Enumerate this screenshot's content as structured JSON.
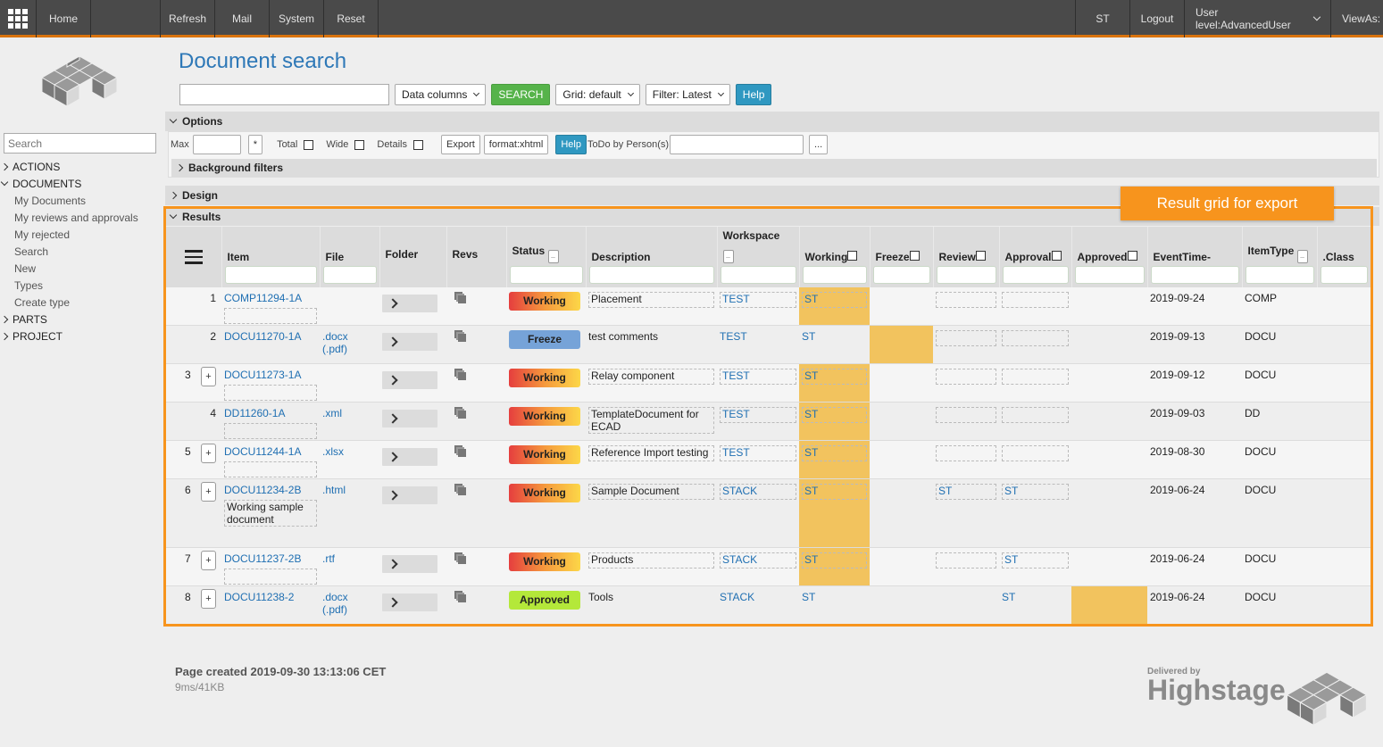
{
  "topbar": {
    "home": "Home",
    "refresh": "Refresh",
    "mail": "Mail",
    "system": "System",
    "reset": "Reset",
    "user": "ST",
    "logout": "Logout",
    "user_level": "User level:AdvancedUser",
    "view_as": "ViewAs:",
    "accent": "#d9730d"
  },
  "sidebar": {
    "search_placeholder": "Search",
    "sections": [
      {
        "label": "ACTIONS",
        "expanded": false
      },
      {
        "label": "DOCUMENTS",
        "expanded": true,
        "items": [
          "My Documents",
          "My reviews and approvals",
          "My rejected",
          "Search",
          "New",
          "Types",
          "Create type"
        ]
      },
      {
        "label": "PARTS",
        "expanded": false
      },
      {
        "label": "PROJECT",
        "expanded": false
      }
    ]
  },
  "page": {
    "title": "Document search",
    "search_value": "",
    "data_columns": "Data columns",
    "search_button": "SEARCH",
    "grid_select": "Grid: default",
    "filter_select": "Filter: Latest",
    "help": "Help"
  },
  "options": {
    "title": "Options",
    "max_label": "Max",
    "max_value": "",
    "star": "*",
    "total": "Total",
    "wide": "Wide",
    "details": "Details",
    "export": "Export",
    "format": "format:xhtml",
    "help": "Help",
    "todo_label": "ToDo by Person(s)",
    "todo_value": "",
    "more": "...",
    "background_filters": "Background filters"
  },
  "design": {
    "title": "Design"
  },
  "results": {
    "title": "Results",
    "callout": "Result grid for export",
    "columns": [
      "Item",
      "File",
      "Folder",
      "Revs",
      "Status",
      "Description",
      "Workspace",
      "Working",
      "Freeze",
      "Review",
      "Approval",
      "Approved",
      "EventTime-",
      "ItemType",
      ".Class"
    ],
    "rows": [
      {
        "num": "1",
        "plus": false,
        "item": "COMP11294-1A",
        "note": "",
        "file": "",
        "file2": "",
        "status": "Working",
        "description": "Placement",
        "workspace": "TEST",
        "working": "ST",
        "freeze": "",
        "review": "",
        "approval": "",
        "approved": "",
        "event_time": "2019-09-24",
        "item_type": "COMP",
        "class": ""
      },
      {
        "num": "2",
        "plus": false,
        "item": "DOCU11270-1A",
        "note": "",
        "file": ".docx",
        "file2": "(.pdf)",
        "status": "Freeze",
        "description": "test comments",
        "workspace": "TEST",
        "working": "ST",
        "freeze": "",
        "review": "",
        "approval": "",
        "approved": "",
        "event_time": "2019-09-13",
        "item_type": "DOCU",
        "class": ""
      },
      {
        "num": "3",
        "plus": true,
        "item": "DOCU11273-1A",
        "note": "",
        "file": "",
        "file2": "",
        "status": "Working",
        "description": "Relay component",
        "workspace": "TEST",
        "working": "ST",
        "freeze": "",
        "review": "",
        "approval": "",
        "approved": "",
        "event_time": "2019-09-12",
        "item_type": "DOCU",
        "class": ""
      },
      {
        "num": "4",
        "plus": false,
        "item": "DD11260-1A",
        "note": "",
        "file": ".xml",
        "file2": "",
        "status": "Working",
        "description": "TemplateDocument for ECAD",
        "workspace": "TEST",
        "working": "ST",
        "freeze": "",
        "review": "",
        "approval": "",
        "approved": "",
        "event_time": "2019-09-03",
        "item_type": "DD",
        "class": ""
      },
      {
        "num": "5",
        "plus": true,
        "item": "DOCU11244-1A",
        "note": "",
        "file": ".xlsx",
        "file2": "",
        "status": "Working",
        "description": "Reference Import testing",
        "workspace": "TEST",
        "working": "ST",
        "freeze": "",
        "review": "",
        "approval": "",
        "approved": "",
        "event_time": "2019-08-30",
        "item_type": "DOCU",
        "class": ""
      },
      {
        "num": "6",
        "plus": true,
        "item": "DOCU11234-2B",
        "note": "Working sample document",
        "file": ".html",
        "file2": "",
        "status": "Working",
        "description": "Sample Document",
        "workspace": "STACK",
        "working": "ST",
        "freeze": "",
        "review": "ST",
        "approval": "ST",
        "approved": "",
        "event_time": "2019-06-24",
        "item_type": "DOCU",
        "class": ""
      },
      {
        "num": "7",
        "plus": true,
        "item": "DOCU11237-2B",
        "note": "",
        "file": ".rtf",
        "file2": "",
        "status": "Working",
        "description": "Products",
        "workspace": "STACK",
        "working": "ST",
        "freeze": "",
        "review": "",
        "approval": "ST",
        "approved": "",
        "event_time": "2019-06-24",
        "item_type": "DOCU",
        "class": ""
      },
      {
        "num": "8",
        "plus": true,
        "item": "DOCU11238-2",
        "note": "",
        "file": ".docx",
        "file2": "(.pdf)",
        "status": "Approved",
        "description": "Tools",
        "workspace": "STACK",
        "working": "ST",
        "freeze": "",
        "review": "",
        "approval": "ST",
        "approved": "",
        "event_time": "2019-06-24",
        "item_type": "DOCU",
        "class": ""
      }
    ],
    "status_colors": {
      "Working": "gradient #e53e3e→#fcd748",
      "Freeze": "#76a3d8",
      "Approved": "#b4e83a"
    },
    "highlight_color": "#f2c35e"
  },
  "footer": {
    "created": "Page created 2019-09-30 13:13:06 CET",
    "stats": "9ms/41KB",
    "delivered_by": "Delivered by",
    "brand": "Highstage"
  }
}
